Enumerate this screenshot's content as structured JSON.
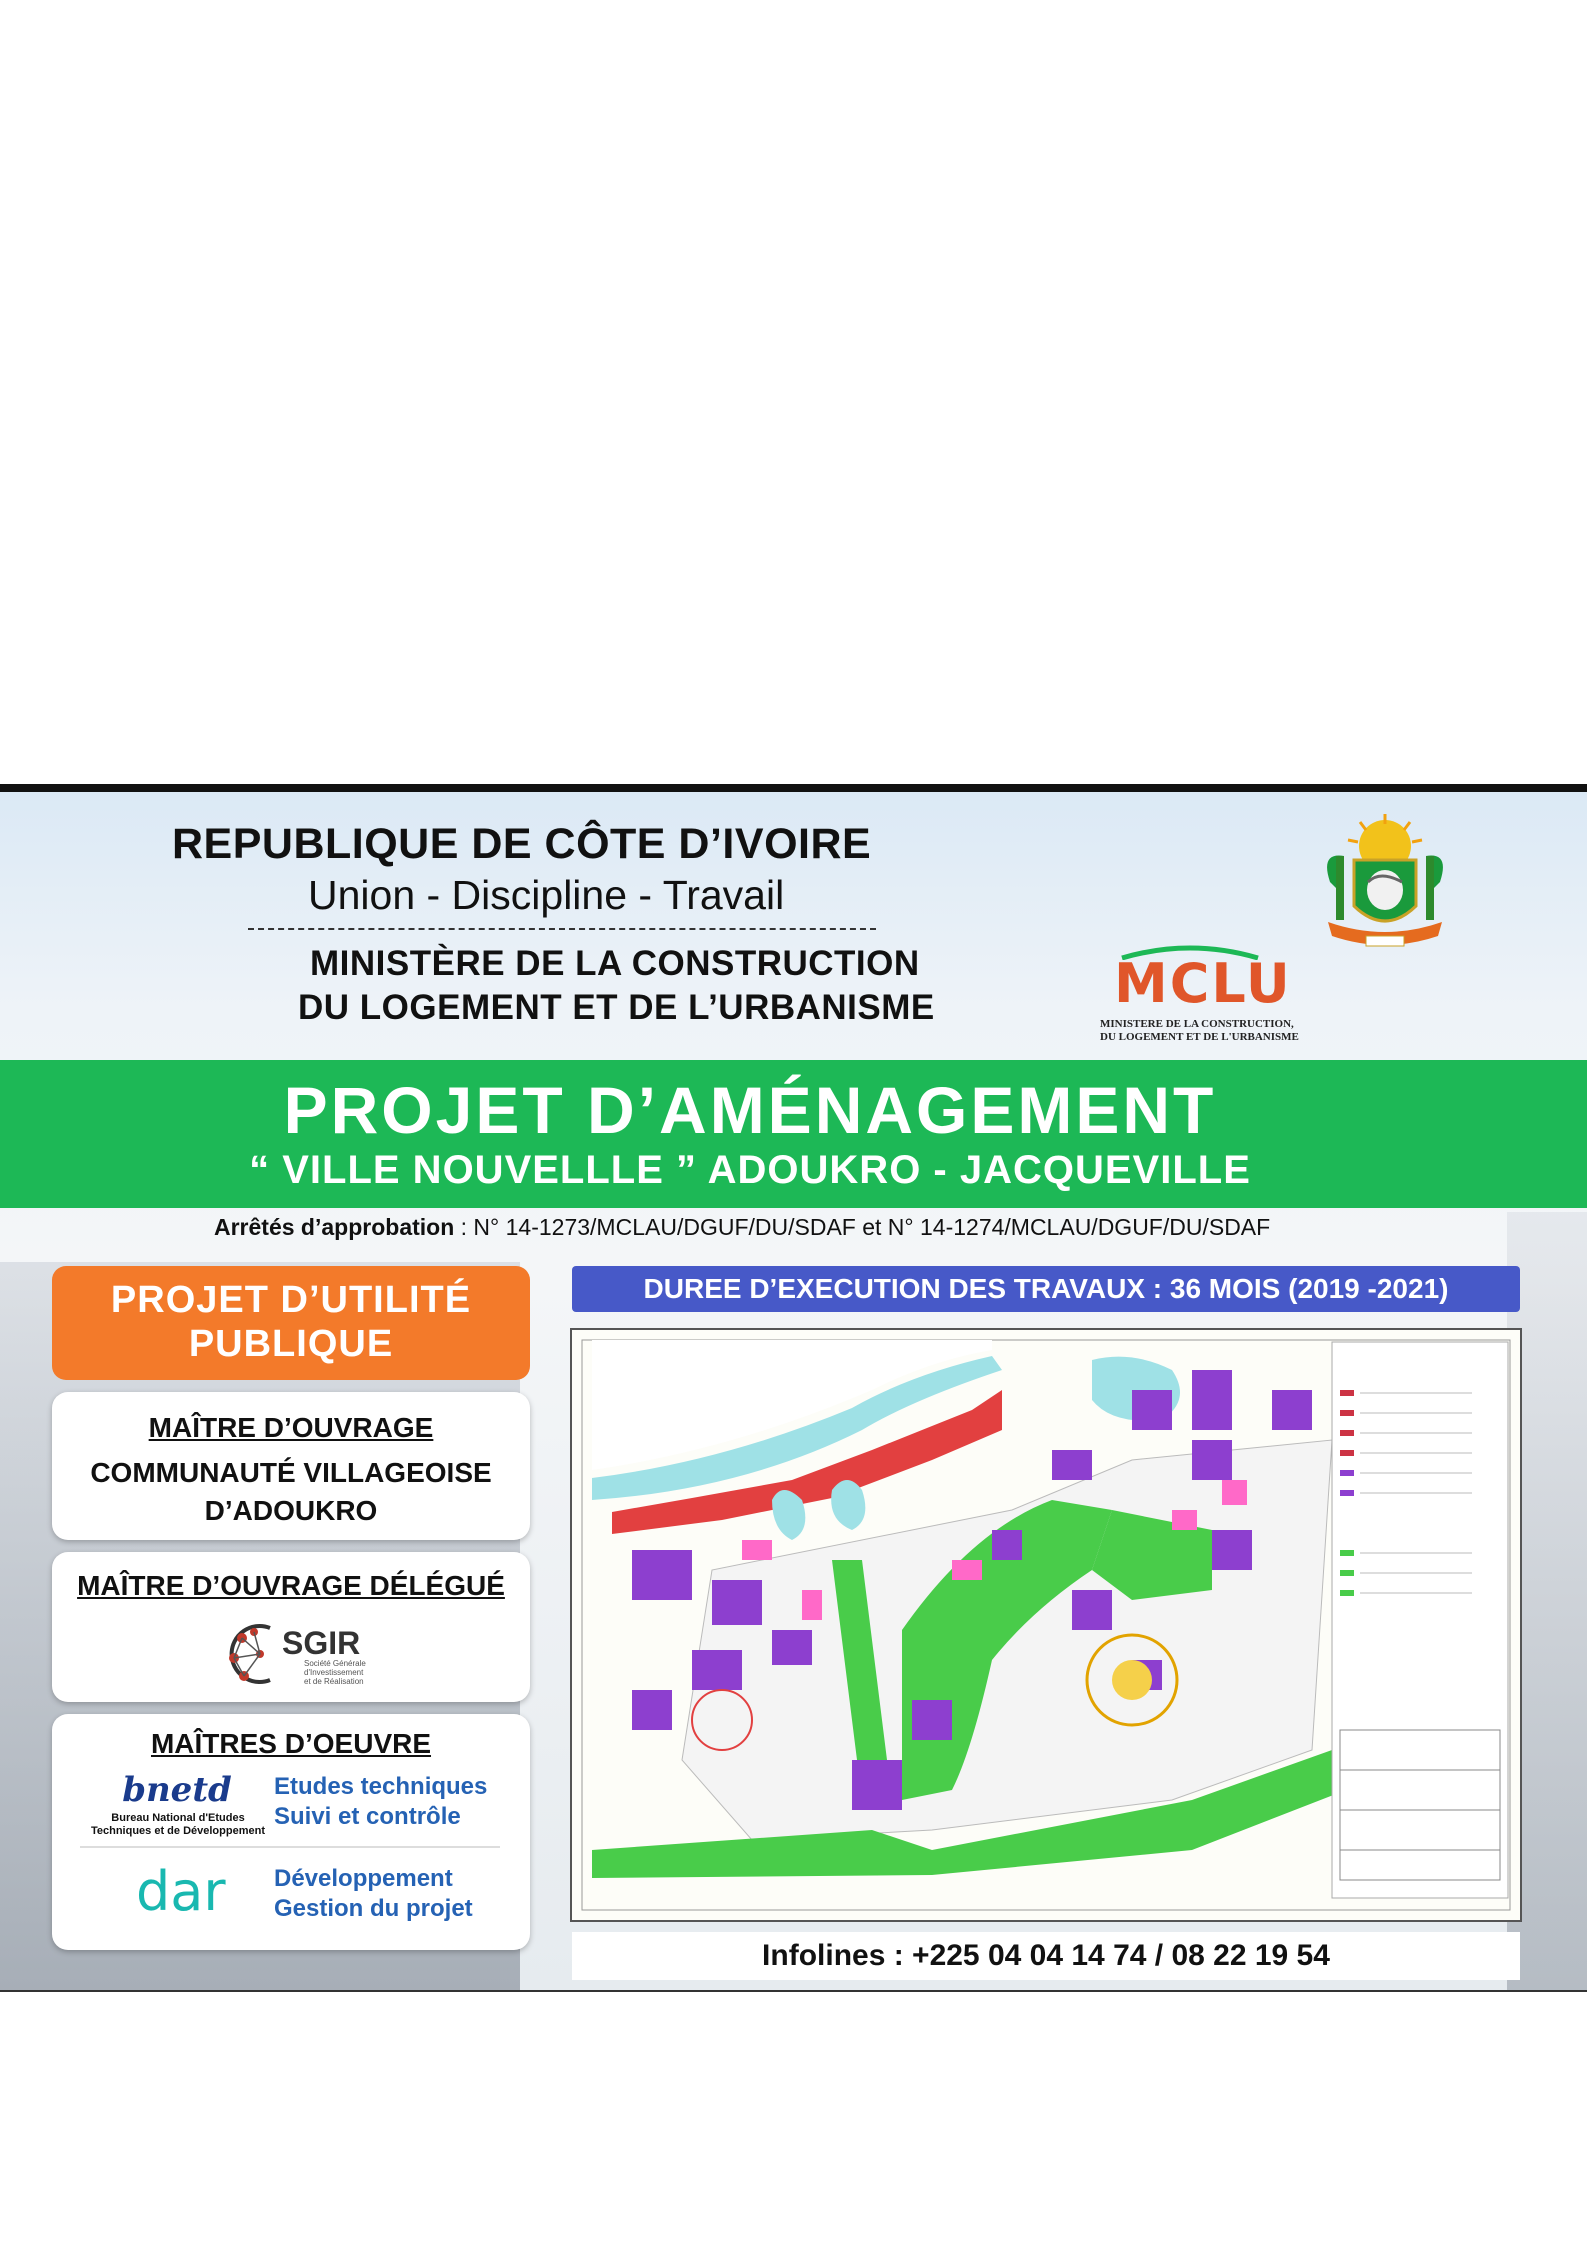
{
  "header": {
    "country": "REPUBLIQUE DE CÔTE D’IVOIRE",
    "motto": "Union - Discipline - Travail",
    "ministry_line1": "MINISTÈRE DE LA CONSTRUCTION",
    "ministry_line2": "DU LOGEMENT ET DE L’URBANISME",
    "logo": {
      "acronym": "MCLU",
      "sub1": "MINISTERE DE LA CONSTRUCTION,",
      "sub2": "DU LOGEMENT ET DE L'URBANISME",
      "colors": {
        "orange": "#e0562a",
        "green": "#1db856"
      }
    },
    "arms_icon": "coat-of-arms-cote-divoire"
  },
  "banner": {
    "title": "PROJET D’AMÉNAGEMENT",
    "subtitle": "“ VILLE NOUVELLLE ” ADOUKRO - JACQUEVILLE",
    "color": "#1db856"
  },
  "approval": {
    "label": "Arrêtés d’approbation",
    "text": " : N° 14-1273/MCLAU/DGUF/DU/SDAF et N° 14-1274/MCLAU/DGUF/DU/SDAF"
  },
  "left": {
    "utility_line1": "PROJET D’UTILITÉ",
    "utility_line2": "PUBLIQUE",
    "owner": {
      "heading": "MAÎTRE D’OUVRAGE",
      "line1": "COMMUNAUTÉ VILLAGEOISE",
      "line2": "D’ADOUKRO"
    },
    "delegated": {
      "heading": "MAÎTRE D’OUVRAGE DÉLÉGUÉ",
      "logo_name": "SGIR",
      "logo_sub": [
        "Société Générale",
        "d'Investissement",
        "et de Réalisation"
      ]
    },
    "contractors": {
      "heading": "MAÎTRES D’OEUVRE",
      "bnetd": {
        "logo": "bnetd",
        "logo_sub1": "Bureau National d'Etudes",
        "logo_sub2": "Techniques et de Développement",
        "role1": "Etudes techniques",
        "role2": "Suivi et contrôle"
      },
      "dar": {
        "logo": "dar",
        "role1": "Développement",
        "role2": "Gestion du projet"
      }
    }
  },
  "right": {
    "duration": "DUREE D’EXECUTION DES TRAVAUX : 36 MOIS (2019 -2021)",
    "map_icon": "urban-development-plan-map",
    "infolines": "Infolines : +225 04 04 14 74 / 08 22 19 54"
  }
}
